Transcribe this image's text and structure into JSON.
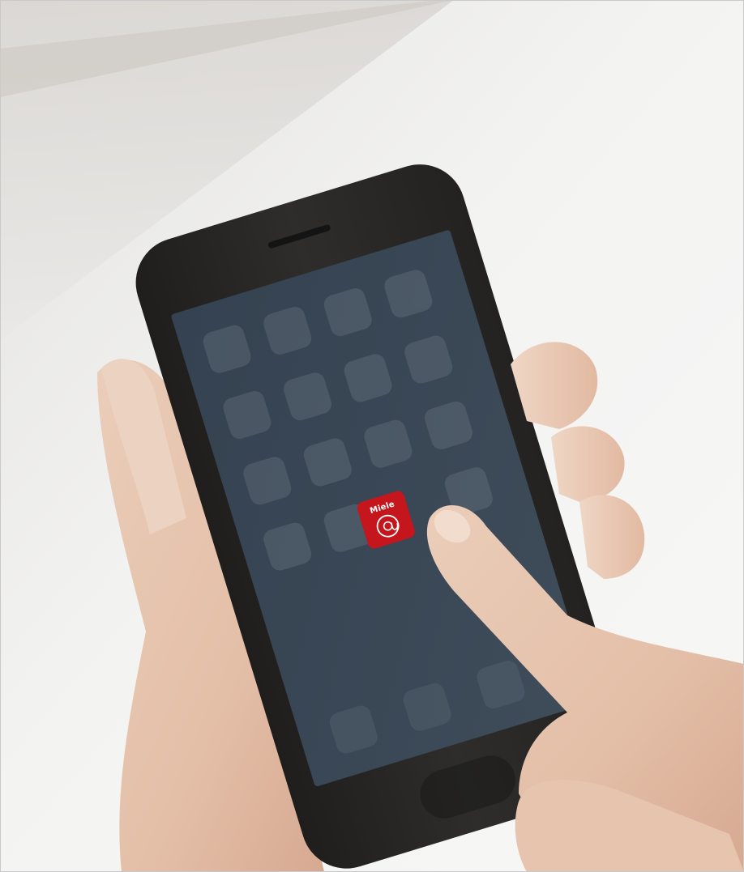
{
  "scene": {
    "description_free": true,
    "background_color": "#f1f1f0",
    "phone_body_color": "#2b2a29",
    "screen_color": "#3a4654"
  },
  "home_screen": {
    "app_icons_dimmed": [
      "app-icon",
      "app-icon",
      "app-icon",
      "app-icon",
      "app-icon",
      "app-icon",
      "app-icon",
      "app-icon",
      "app-icon",
      "app-icon",
      "app-icon",
      "app-icon",
      "app-icon",
      "app-icon",
      "app-icon",
      "app-icon"
    ],
    "dock_icons": [
      "phone-icon",
      "mail-icon",
      "browser-icon"
    ]
  },
  "featured_app": {
    "brand_label": "Miele",
    "icon": "at-sign-icon",
    "accent_color": "#c4161c"
  }
}
